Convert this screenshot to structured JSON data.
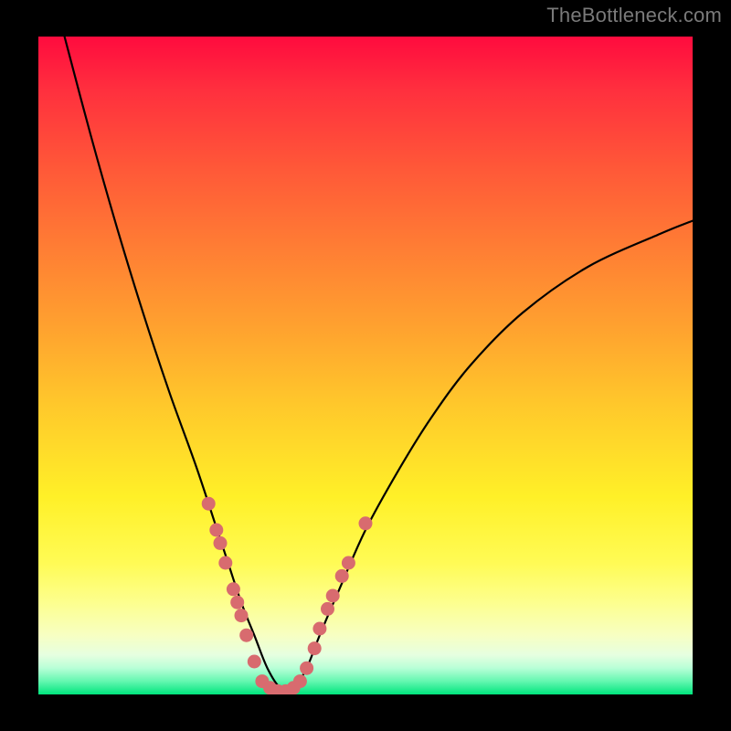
{
  "watermark": "TheBottleneck.com",
  "colors": {
    "black": "#000000",
    "dot": "#d86b6f",
    "gradient_top": "#ff0b3e",
    "gradient_bottom": "#00e57d"
  },
  "chart_data": {
    "type": "line",
    "title": "",
    "xlabel": "",
    "ylabel": "",
    "xlim": [
      0,
      100
    ],
    "ylim": [
      0,
      100
    ],
    "note": "Y is plotted with 0 at the bottom (green) and 100 at the top (red). The curve is the absolute deviation from an optimal match; the minimum (y≈0) is near x≈37.",
    "series": [
      {
        "name": "curve",
        "x": [
          4,
          8,
          12,
          16,
          20,
          24,
          27,
          29,
          31,
          33,
          35,
          37,
          39,
          41,
          43,
          46,
          50,
          55,
          60,
          66,
          74,
          84,
          95,
          100
        ],
        "y": [
          100,
          85,
          71,
          58,
          46,
          35,
          26,
          20,
          14,
          9,
          4,
          1,
          1,
          4,
          9,
          16,
          25,
          34,
          42,
          50,
          58,
          65,
          70,
          72
        ]
      }
    ],
    "markers": [
      {
        "x": 26.0,
        "y": 29
      },
      {
        "x": 27.2,
        "y": 25
      },
      {
        "x": 27.8,
        "y": 23
      },
      {
        "x": 28.6,
        "y": 20
      },
      {
        "x": 29.8,
        "y": 16
      },
      {
        "x": 30.4,
        "y": 14
      },
      {
        "x": 31.0,
        "y": 12
      },
      {
        "x": 31.8,
        "y": 9
      },
      {
        "x": 33.0,
        "y": 5
      },
      {
        "x": 34.2,
        "y": 2
      },
      {
        "x": 35.4,
        "y": 1
      },
      {
        "x": 36.6,
        "y": 0.5
      },
      {
        "x": 37.8,
        "y": 0.5
      },
      {
        "x": 39.0,
        "y": 1
      },
      {
        "x": 40.0,
        "y": 2
      },
      {
        "x": 41.0,
        "y": 4
      },
      {
        "x": 42.2,
        "y": 7
      },
      {
        "x": 43.0,
        "y": 10
      },
      {
        "x": 44.2,
        "y": 13
      },
      {
        "x": 45.0,
        "y": 15
      },
      {
        "x": 46.4,
        "y": 18
      },
      {
        "x": 47.4,
        "y": 20
      },
      {
        "x": 50.0,
        "y": 26
      }
    ]
  }
}
